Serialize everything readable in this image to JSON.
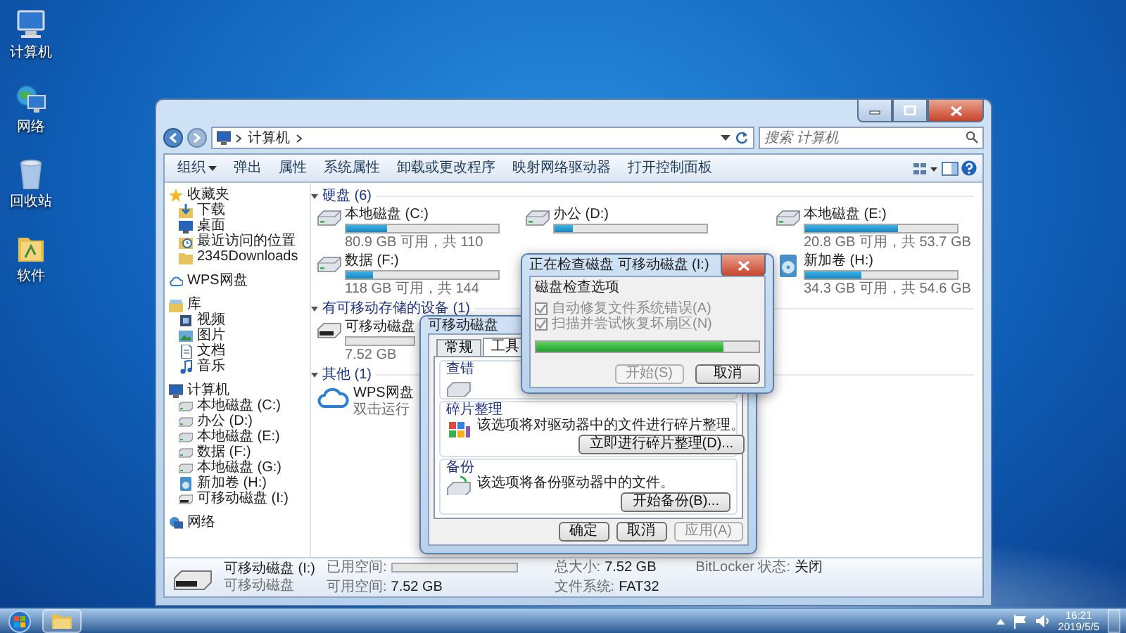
{
  "desktop": {
    "icons": [
      {
        "label": "计算机",
        "kind": "computer"
      },
      {
        "label": "网络",
        "kind": "network"
      },
      {
        "label": "回收站",
        "kind": "recycle"
      },
      {
        "label": "软件",
        "kind": "folder"
      }
    ]
  },
  "explorer": {
    "address": {
      "path": [
        "计算机"
      ],
      "search_placeholder": "搜索 计算机"
    },
    "toolbar": [
      {
        "label": "组织",
        "kind": "menu"
      },
      {
        "label": "弹出",
        "kind": "button"
      },
      {
        "label": "属性",
        "kind": "button"
      },
      {
        "label": "系统属性",
        "kind": "button"
      },
      {
        "label": "卸载或更改程序",
        "kind": "button"
      },
      {
        "label": "映射网络驱动器",
        "kind": "button"
      },
      {
        "label": "打开控制面板",
        "kind": "button"
      }
    ],
    "nav": [
      {
        "label": "收藏夹",
        "kind": "star",
        "children": [
          {
            "label": "下载",
            "kind": "download"
          },
          {
            "label": "桌面",
            "kind": "desktop"
          },
          {
            "label": "最近访问的位置",
            "kind": "recent"
          },
          {
            "label": "2345Downloads",
            "kind": "folder"
          }
        ]
      },
      {
        "label": "WPS网盘",
        "kind": "cloud"
      },
      {
        "label": "库",
        "kind": "library",
        "children": [
          {
            "label": "视频",
            "kind": "video"
          },
          {
            "label": "图片",
            "kind": "pictures"
          },
          {
            "label": "文档",
            "kind": "docs"
          },
          {
            "label": "音乐",
            "kind": "music"
          }
        ]
      },
      {
        "label": "计算机",
        "kind": "computer",
        "children": [
          {
            "label": "本地磁盘 (C:)",
            "kind": "drive"
          },
          {
            "label": "办公 (D:)",
            "kind": "drive"
          },
          {
            "label": "本地磁盘 (E:)",
            "kind": "drive"
          },
          {
            "label": "数据 (F:)",
            "kind": "drive"
          },
          {
            "label": "本地磁盘 (G:)",
            "kind": "drive"
          },
          {
            "label": "新加卷 (H:)",
            "kind": "volume"
          },
          {
            "label": "可移动磁盘 (I:)",
            "kind": "usb"
          }
        ]
      },
      {
        "label": "网络",
        "kind": "network"
      }
    ],
    "groups": [
      {
        "title": "硬盘 (6)",
        "items": [
          {
            "kind": "hdd",
            "name": "本地磁盘 (C:)",
            "level": 0.27,
            "usage": "80.9 GB 可用，共 110"
          },
          {
            "kind": "hdd",
            "name": "办公 (D:)",
            "level": 0.12
          },
          {
            "kind": "hdd",
            "name": "本地磁盘 (E:)",
            "level": 0.61,
            "usage": "20.8 GB 可用，共 53.7 GB"
          },
          {
            "kind": "hdd",
            "name": "数据 (F:)",
            "level": 0.18,
            "usage": "118 GB 可用，共 144"
          },
          {
            "kind": "volume",
            "name": "新加卷 (H:)",
            "level": 0.37,
            "usage": "34.3 GB 可用，共 54.6 GB"
          }
        ]
      },
      {
        "title": "有可移动存储的设备 (1)",
        "items": [
          {
            "kind": "usb",
            "name": "可移动磁盘",
            "level": 0,
            "usage": "7.52 GB"
          }
        ]
      },
      {
        "title": "其他 (1)",
        "items": [
          {
            "kind": "cloud",
            "name": "WPS网盘",
            "usage": "双击运行"
          }
        ]
      }
    ],
    "details": {
      "name": "可移动磁盘 (I:)",
      "type": "可移动磁盘",
      "used": {
        "label": "已用空间:",
        "level": 0
      },
      "fields": [
        {
          "label": "可用空间:",
          "value": "7.52 GB"
        },
        {
          "label": "总大小:",
          "value": "7.52 GB"
        },
        {
          "label": "文件系统:",
          "value": "FAT32"
        },
        {
          "label": "BitLocker 状态:",
          "value": "关闭"
        }
      ]
    }
  },
  "properties_dialog": {
    "title": "可移动磁盘",
    "tabs": [
      {
        "label": "常规",
        "selected": false
      },
      {
        "label": "工具",
        "selected": true
      }
    ],
    "groups": [
      {
        "kind": "check",
        "title": "查错"
      },
      {
        "kind": "defrag",
        "title": "碎片整理",
        "text": "该选项将对驱动器中的文件进行碎片整理。",
        "button": "立即进行碎片整理(D)..."
      },
      {
        "kind": "backup",
        "title": "备份",
        "text": "该选项将备份驱动器中的文件。",
        "button": "开始备份(B)..."
      }
    ],
    "buttons": [
      {
        "label": "确定",
        "disabled": false
      },
      {
        "label": "取消",
        "disabled": false
      },
      {
        "label": "应用(A)",
        "disabled": true
      }
    ]
  },
  "check_dialog": {
    "title": "正在检查磁盘 可移动磁盘 (I:)",
    "section": "磁盘检查选项",
    "options": [
      {
        "label": "自动修复文件系统错误(A)",
        "checked": true,
        "disabled": true
      },
      {
        "label": "扫描并尝试恢复坏扇区(N)",
        "checked": true,
        "disabled": true
      }
    ],
    "progress": {
      "level": 0.84
    },
    "buttons": [
      {
        "label": "开始(S)",
        "disabled": true
      },
      {
        "label": "取消",
        "disabled": false
      }
    ]
  },
  "taskbar": {
    "clock": {
      "time": "16:21",
      "date": "2019/5/5"
    }
  }
}
